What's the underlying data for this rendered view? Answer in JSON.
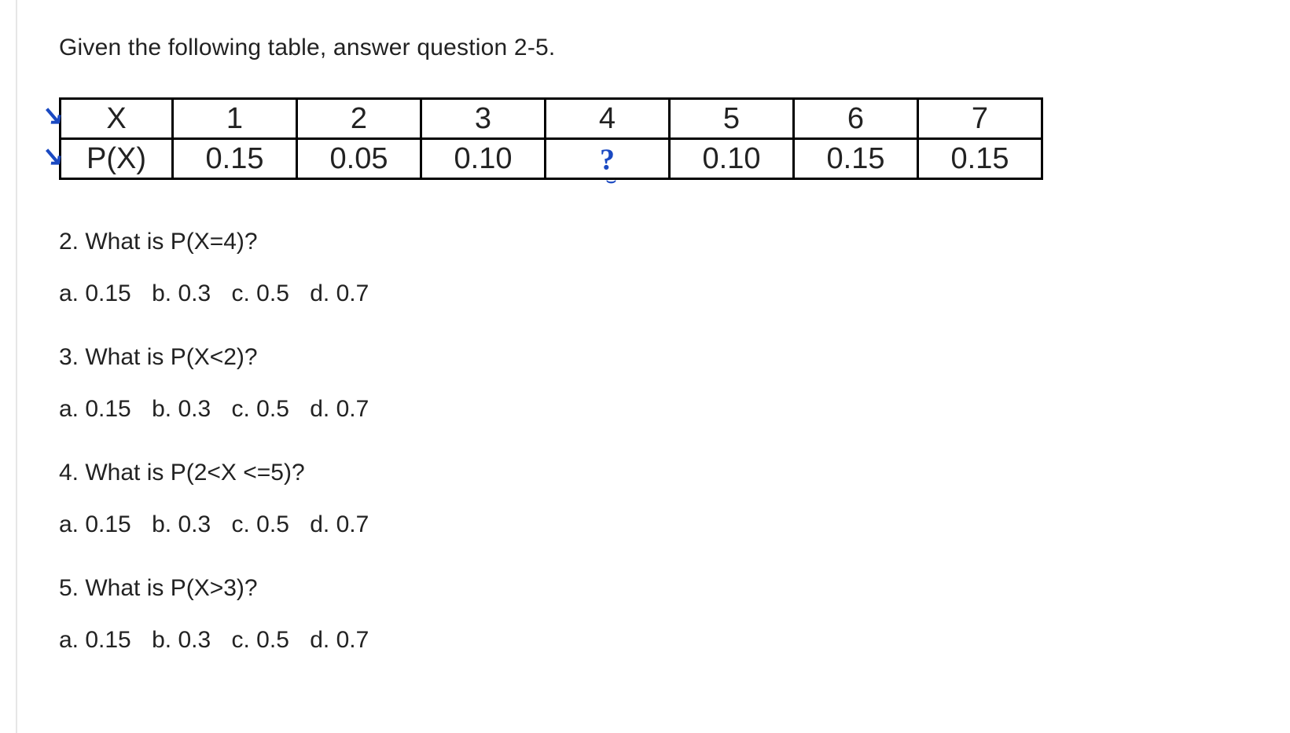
{
  "intro": "Given the following table, answer question 2-5.",
  "table": {
    "row1": {
      "label": "X",
      "c1": "1",
      "c2": "2",
      "c3": "3",
      "c4": "4",
      "c5": "5",
      "c6": "6",
      "c7": "7"
    },
    "row2": {
      "label": "P(X)",
      "c1": "0.15",
      "c2": "0.05",
      "c3": "0.10",
      "c4": "?",
      "c5": "0.10",
      "c6": "0.15",
      "c7": "0.15"
    }
  },
  "questions": {
    "q2": {
      "text": "2. What is P(X=4)?",
      "a": "a. 0.15",
      "b": "b. 0.3",
      "c": "c. 0.5",
      "d": "d. 0.7"
    },
    "q3": {
      "text": "3. What is P(X<2)?",
      "a": "a. 0.15",
      "b": "b. 0.3",
      "c": "c. 0.5",
      "d": "d. 0.7"
    },
    "q4": {
      "text": "4. What is P(2<X <=5)?",
      "a": "a. 0.15",
      "b": "b. 0.3",
      "c": "c. 0.5",
      "d": "d. 0.7"
    },
    "q5": {
      "text": "5. What is P(X>3)?",
      "a": "a. 0.15",
      "b": "b. 0.3",
      "c": "c. 0.5",
      "d": "d. 0.7"
    }
  },
  "annotations": {
    "arrow_glyph": "↘",
    "unknown_glyph": "?"
  }
}
